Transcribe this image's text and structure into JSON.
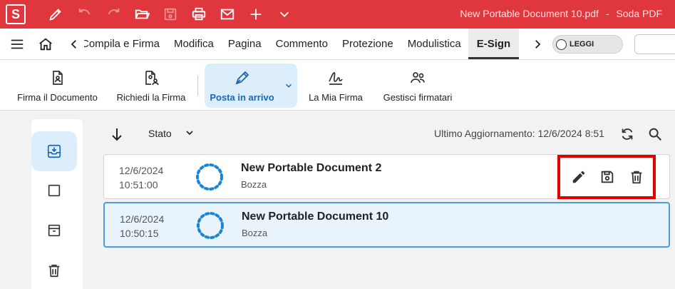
{
  "app": {
    "logo_letter": "S",
    "document_title": "New Portable Document 10.pdf",
    "separator": "-",
    "app_name": "Soda PDF"
  },
  "quick_access": [
    "pen-icon",
    "undo-icon",
    "redo-icon",
    "folder-open-icon",
    "save-icon",
    "print-icon",
    "mail-icon",
    "plus-icon",
    "chevron-down-icon"
  ],
  "menu": {
    "tabs": [
      {
        "label": "Compila e Firma",
        "active": false
      },
      {
        "label": "Modifica",
        "active": false
      },
      {
        "label": "Pagina",
        "active": false
      },
      {
        "label": "Commento",
        "active": false
      },
      {
        "label": "Protezione",
        "active": false
      },
      {
        "label": "Modulistica",
        "active": false
      },
      {
        "label": "E-Sign",
        "active": true
      }
    ],
    "read_mode_label": "LEGGI"
  },
  "ribbon": {
    "sign_document": "Firma il Documento",
    "request_signature": "Richiedi la Firma",
    "inbox": "Posta in arrivo",
    "my_signature": "La Mia Firma",
    "manage_signers": "Gestisci firmatari"
  },
  "list": {
    "filter_label": "Stato",
    "updated_label": "Ultimo Aggiornamento:",
    "updated_value": "12/6/2024 8:51",
    "rows": [
      {
        "date": "12/6/2024",
        "time": "10:51:00",
        "name": "New Portable Document 2",
        "status": "Bozza",
        "selected": false
      },
      {
        "date": "12/6/2024",
        "time": "10:50:15",
        "name": "New Portable Document 10",
        "status": "Bozza",
        "selected": true
      }
    ]
  },
  "colors": {
    "brand": "#e0363e",
    "accent_blue": "#1766b8",
    "selection_bg": "#e8f3fc",
    "highlight_box": "#e00000"
  }
}
